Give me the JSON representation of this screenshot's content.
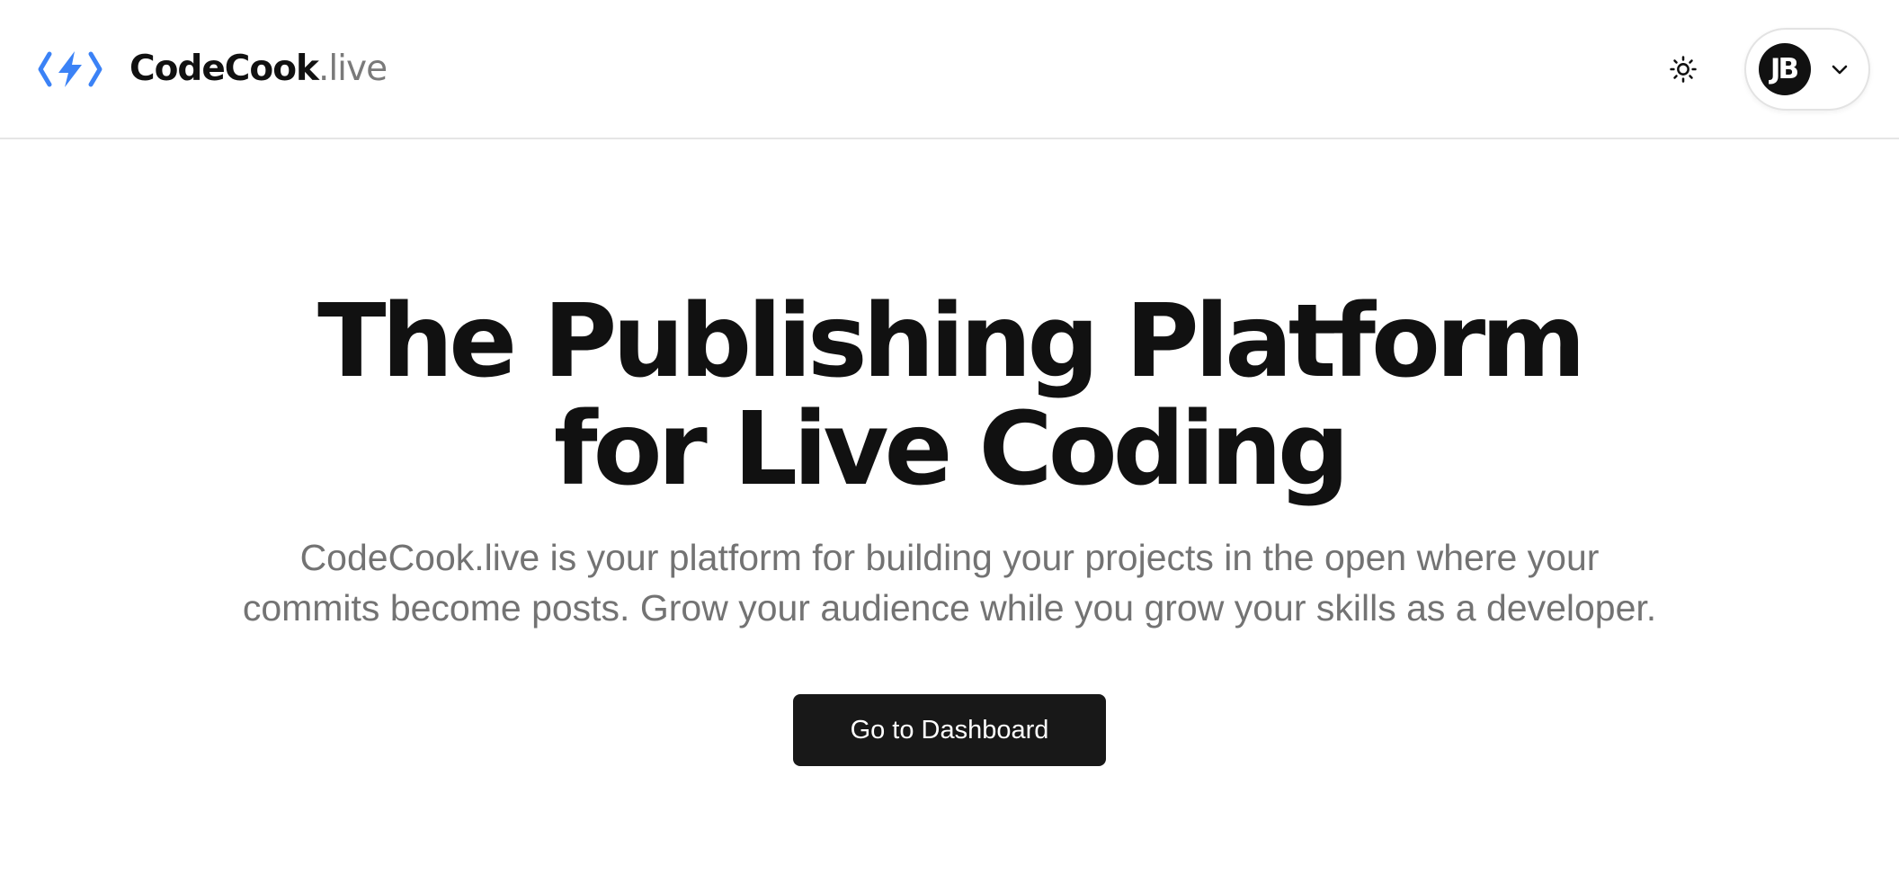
{
  "header": {
    "brand_name": "CodeCook",
    "brand_suffix": ".live",
    "logo_icon": "code-bolt-icon",
    "theme_icon": "sun-icon",
    "user": {
      "initials": "JB",
      "menu_icon": "chevron-down-icon"
    }
  },
  "hero": {
    "title_line_1": "The Publishing Platform",
    "title_line_2": "for Live Coding",
    "subtitle_line_1": "CodeCook.live is your platform for building your projects in the open where your",
    "subtitle_line_2": "commits become posts. Grow your audience while you grow your skills as a developer.",
    "cta_label": "Go to Dashboard"
  },
  "colors": {
    "accent": "#3b82f6",
    "text_primary": "#111111",
    "text_muted": "#737373",
    "button_bg": "#181818",
    "border": "#e5e5e5"
  }
}
